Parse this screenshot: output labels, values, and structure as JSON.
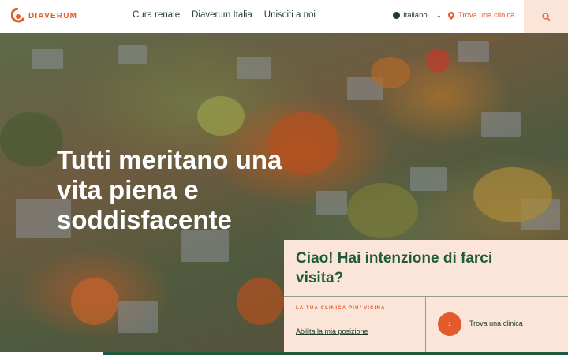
{
  "brand": {
    "name": "DIAVERUM",
    "accent": "#e35a2b",
    "green": "#1f5a3a"
  },
  "nav": {
    "items": [
      "Cura renale",
      "Diaverum Italia",
      "Unisciti a noi"
    ]
  },
  "header": {
    "language": "Italiano",
    "find_clinic": "Trova una clinica",
    "search_icon": "search-icon"
  },
  "hero": {
    "title": "Tutti meritano una vita piena e soddisfacente"
  },
  "visit_card": {
    "title": "Ciao! Hai intenzione di farci visita?",
    "label": "LA TUA CLINICA PIU' VICINA",
    "enable_location": "Abilita la mia posizione",
    "find_clinic": "Trova una clinica"
  }
}
